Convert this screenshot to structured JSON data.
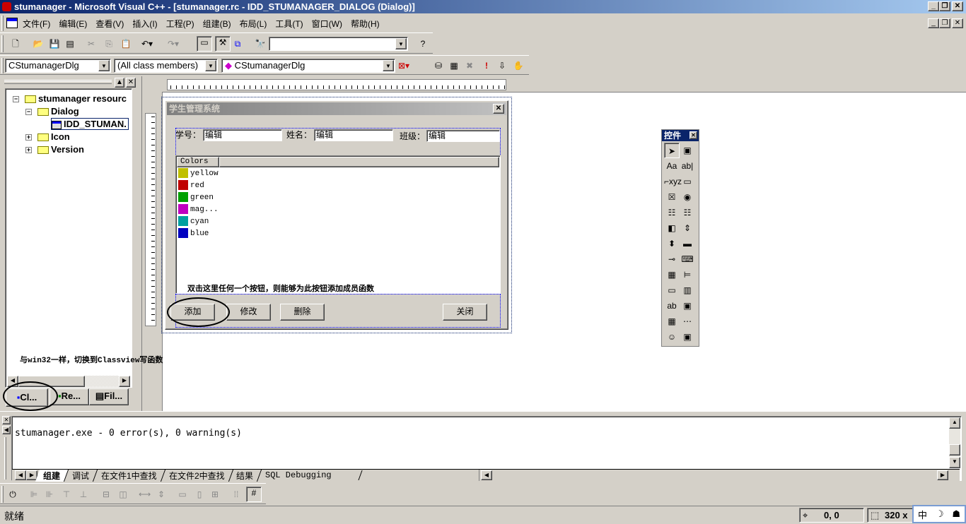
{
  "window": {
    "title": "stumanager - Microsoft Visual C++ - [stumanager.rc - IDD_STUMANAGER_DIALOG (Dialog)]",
    "min": "_",
    "restore": "❐",
    "close": "✕"
  },
  "menu": [
    "文件(F)",
    "编辑(E)",
    "查看(V)",
    "插入(I)",
    "工程(P)",
    "组建(B)",
    "布局(L)",
    "工具(T)",
    "窗口(W)",
    "帮助(H)"
  ],
  "toolbar": {
    "find_value": ""
  },
  "wizardbar": {
    "class": "CStumanagerDlg",
    "filter": "(All class members)",
    "member": "CStumanagerDlg"
  },
  "workspace": {
    "root": "stumanager resourc",
    "dialog": "Dialog",
    "dialog_item": "IDD_STUMAN.",
    "icon": "Icon",
    "version": "Version",
    "annotation": "与win32一样，切换到Classview写函数",
    "tabs": [
      "Cl...",
      "Re...",
      "Fil..."
    ]
  },
  "dialog": {
    "title": "学生管理系统",
    "close": "✕",
    "labels": [
      "学号：",
      "姓名：",
      "班级："
    ],
    "fields": [
      "编辑",
      "编辑",
      "编辑"
    ],
    "list_header": "Colors",
    "items": [
      {
        "name": "yellow",
        "color": "#c0c000"
      },
      {
        "name": "red",
        "color": "#c00000"
      },
      {
        "name": "green",
        "color": "#00a000"
      },
      {
        "name": "mag...",
        "color": "#c000c0"
      },
      {
        "name": "cyan",
        "color": "#00a0a0"
      },
      {
        "name": "blue",
        "color": "#0000c0"
      }
    ],
    "hint": "双击这里任何一个按钮，则能够为此按钮添加成员函数",
    "buttons": [
      "添加",
      "修改",
      "删除",
      "关闭"
    ]
  },
  "controls": {
    "title": "控件",
    "close": "✕",
    "tools": [
      "➤",
      "▣",
      "Aa",
      "ab|",
      "⌐xyz",
      "▭",
      "☒",
      "◉",
      "☷",
      "☷",
      "◧",
      "⇕",
      "⬍",
      "▬",
      "⊸",
      "⌨",
      "▦",
      "⊨",
      "▭",
      "▥",
      "ab",
      "▣",
      "▦",
      "⋯",
      "☺",
      "▣"
    ]
  },
  "output": {
    "text": "stumanager.exe - 0 error(s), 0 warning(s)",
    "tabs": [
      "组建",
      "调试",
      "在文件1中查找",
      "在文件2中查找",
      "结果",
      "SQL Debugging"
    ]
  },
  "status": {
    "text": "就绪",
    "position": "0, 0",
    "size": "320 x",
    "ime": [
      "中",
      "☽",
      "☗"
    ]
  }
}
